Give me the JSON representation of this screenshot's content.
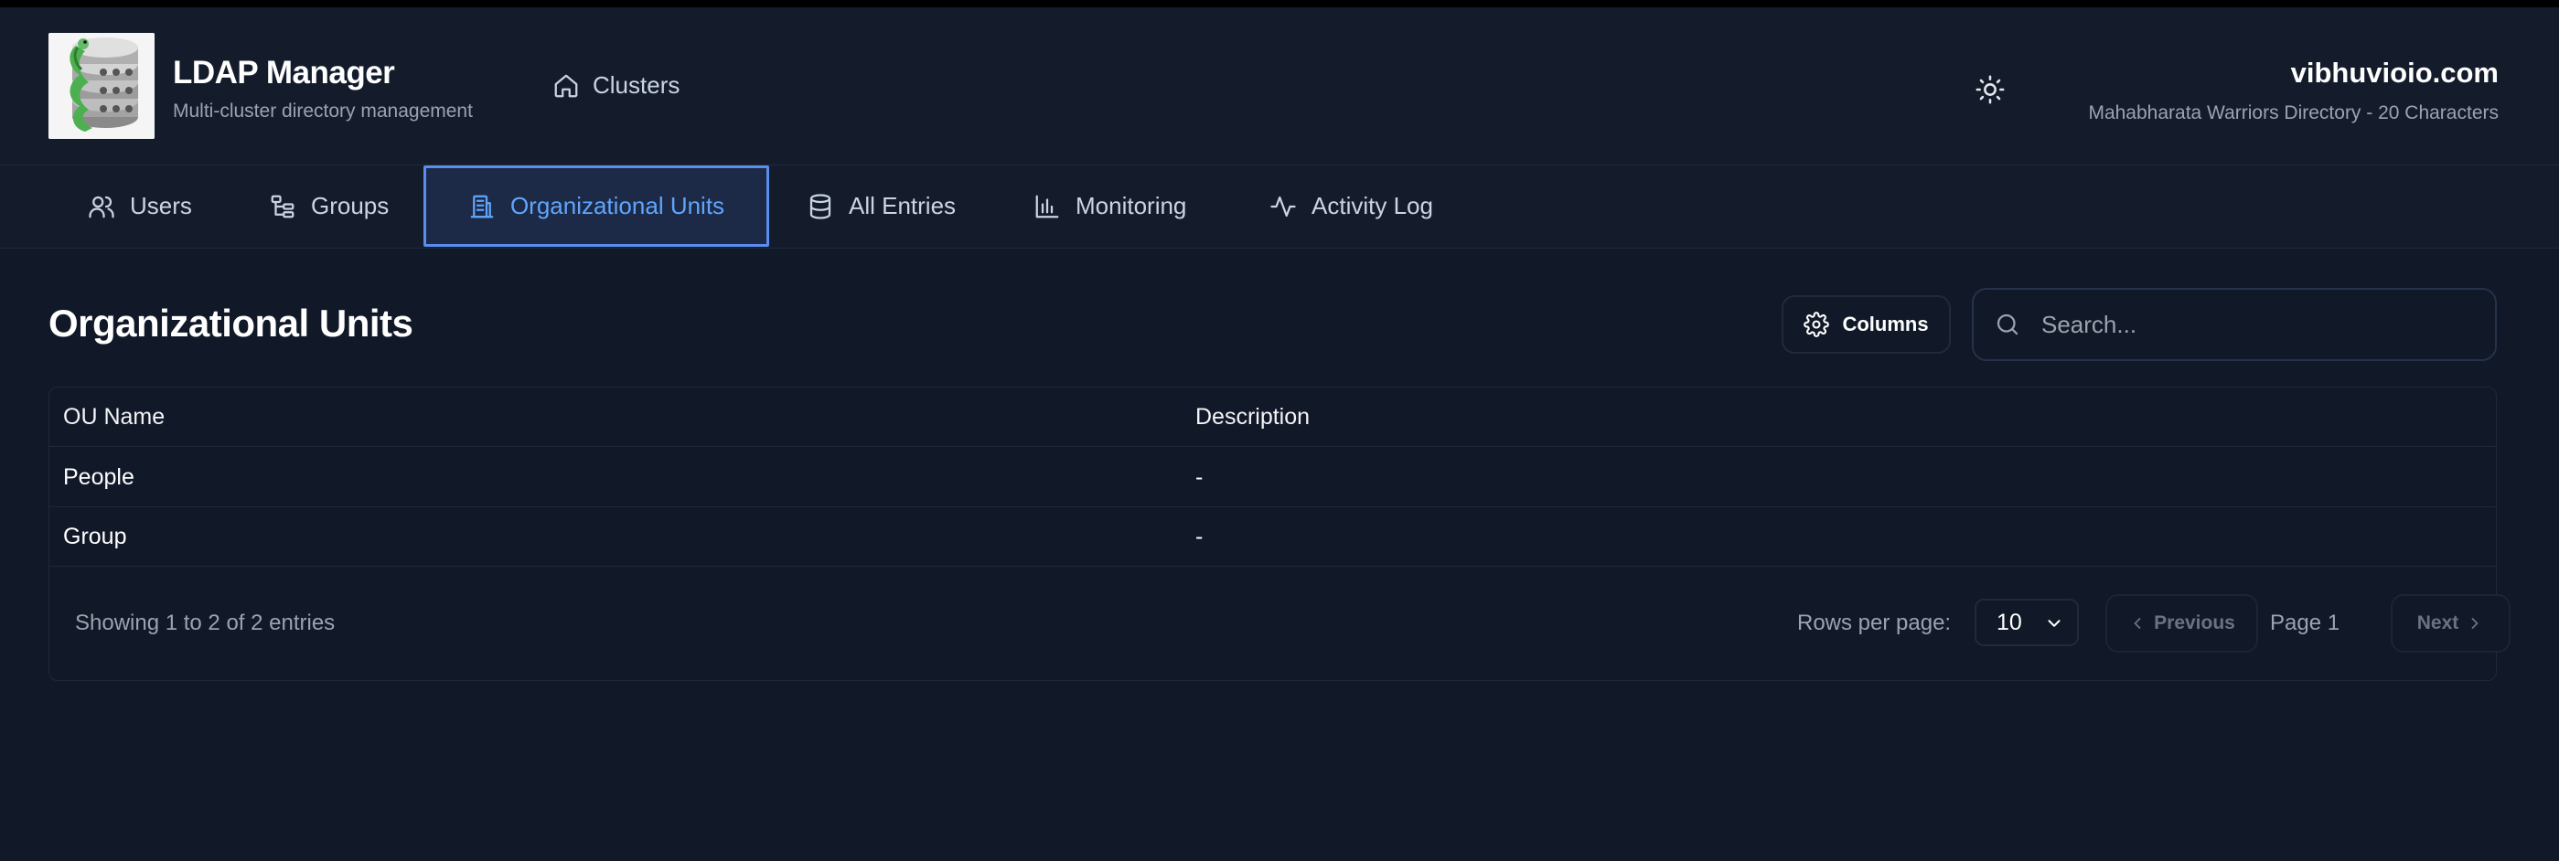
{
  "header": {
    "app_title": "LDAP Manager",
    "app_subtitle": "Multi-cluster directory management",
    "clusters_label": "Clusters",
    "domain_name": "vibhuvioio.com",
    "domain_description": "Mahabharata Warriors Directory - 20 Characters"
  },
  "tabs": [
    {
      "label": "Users",
      "icon": "users-icon",
      "active": false
    },
    {
      "label": "Groups",
      "icon": "hierarchy-icon",
      "active": false
    },
    {
      "label": "Organizational Units",
      "icon": "building-icon",
      "active": true
    },
    {
      "label": "All Entries",
      "icon": "database-icon",
      "active": false
    },
    {
      "label": "Monitoring",
      "icon": "bar-chart-icon",
      "active": false
    },
    {
      "label": "Activity Log",
      "icon": "activity-icon",
      "active": false
    }
  ],
  "main": {
    "page_title": "Organizational Units",
    "columns_button": "Columns",
    "search_placeholder": "Search..."
  },
  "table": {
    "headers": [
      "OU Name",
      "Description"
    ],
    "rows": [
      [
        "People",
        "-"
      ],
      [
        "Group",
        "-"
      ]
    ]
  },
  "pagination": {
    "showing": "Showing 1 to 2 of 2 entries",
    "rows_per_page_label": "Rows per page:",
    "rows_per_page_value": "10",
    "previous": "Previous",
    "page": "Page 1",
    "next": "Next"
  },
  "colors": {
    "background": "#111827",
    "accent": "#60a5fa",
    "active_tab_bg": "#1c2a47"
  }
}
